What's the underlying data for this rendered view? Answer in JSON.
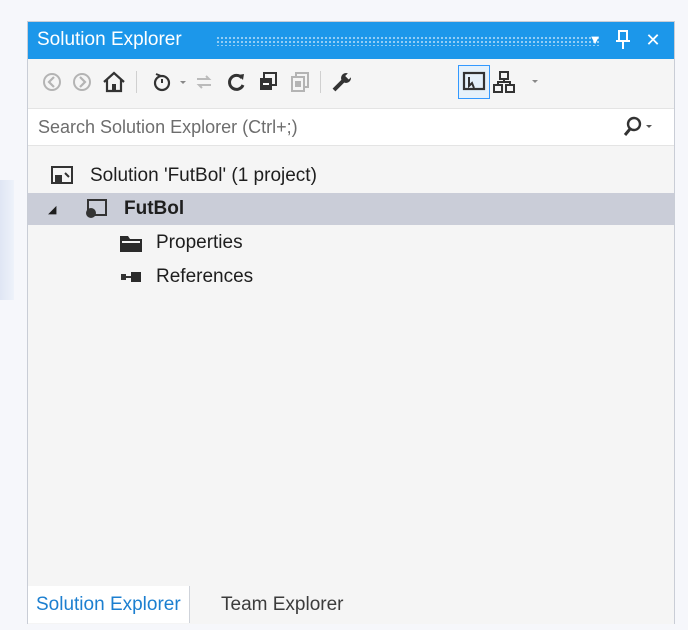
{
  "window": {
    "title": "Solution Explorer",
    "controls": {
      "dropdown": "▼",
      "pin": "⊥",
      "close": "✕"
    }
  },
  "toolbar": {
    "buttons": [
      {
        "name": "back-icon",
        "enabled": false
      },
      {
        "name": "forward-icon",
        "enabled": false
      },
      {
        "name": "home-icon",
        "enabled": true
      },
      {
        "name": "pending-changes-filter-icon",
        "enabled": true,
        "dropdown": true
      },
      {
        "name": "sync-with-active-document-icon",
        "enabled": false
      },
      {
        "name": "refresh-icon",
        "enabled": true
      },
      {
        "name": "collapse-all-icon",
        "enabled": true
      },
      {
        "name": "show-all-files-icon",
        "enabled": false
      },
      {
        "name": "properties-icon",
        "enabled": true
      },
      {
        "name": "preview-selected-items-icon",
        "enabled": true,
        "active": true
      },
      {
        "name": "view-class-diagram-icon",
        "enabled": true,
        "dropdown": true
      }
    ]
  },
  "search": {
    "placeholder": "Search Solution Explorer (Ctrl+;)",
    "icon": "search-icon"
  },
  "tree": {
    "solution_label": "Solution 'FutBol' (1 project)",
    "project_label": "FutBol",
    "project_expanded": true,
    "children": [
      {
        "label": "Properties",
        "icon": "properties-folder-icon"
      },
      {
        "label": "References",
        "icon": "references-icon"
      }
    ]
  },
  "tabs": [
    {
      "label": "Solution Explorer",
      "active": true
    },
    {
      "label": "Team Explorer",
      "active": false
    }
  ],
  "colors": {
    "title_bar": "#1c97ea",
    "selection": "#cacdd8",
    "active_tab_text": "#1c7fd0"
  }
}
